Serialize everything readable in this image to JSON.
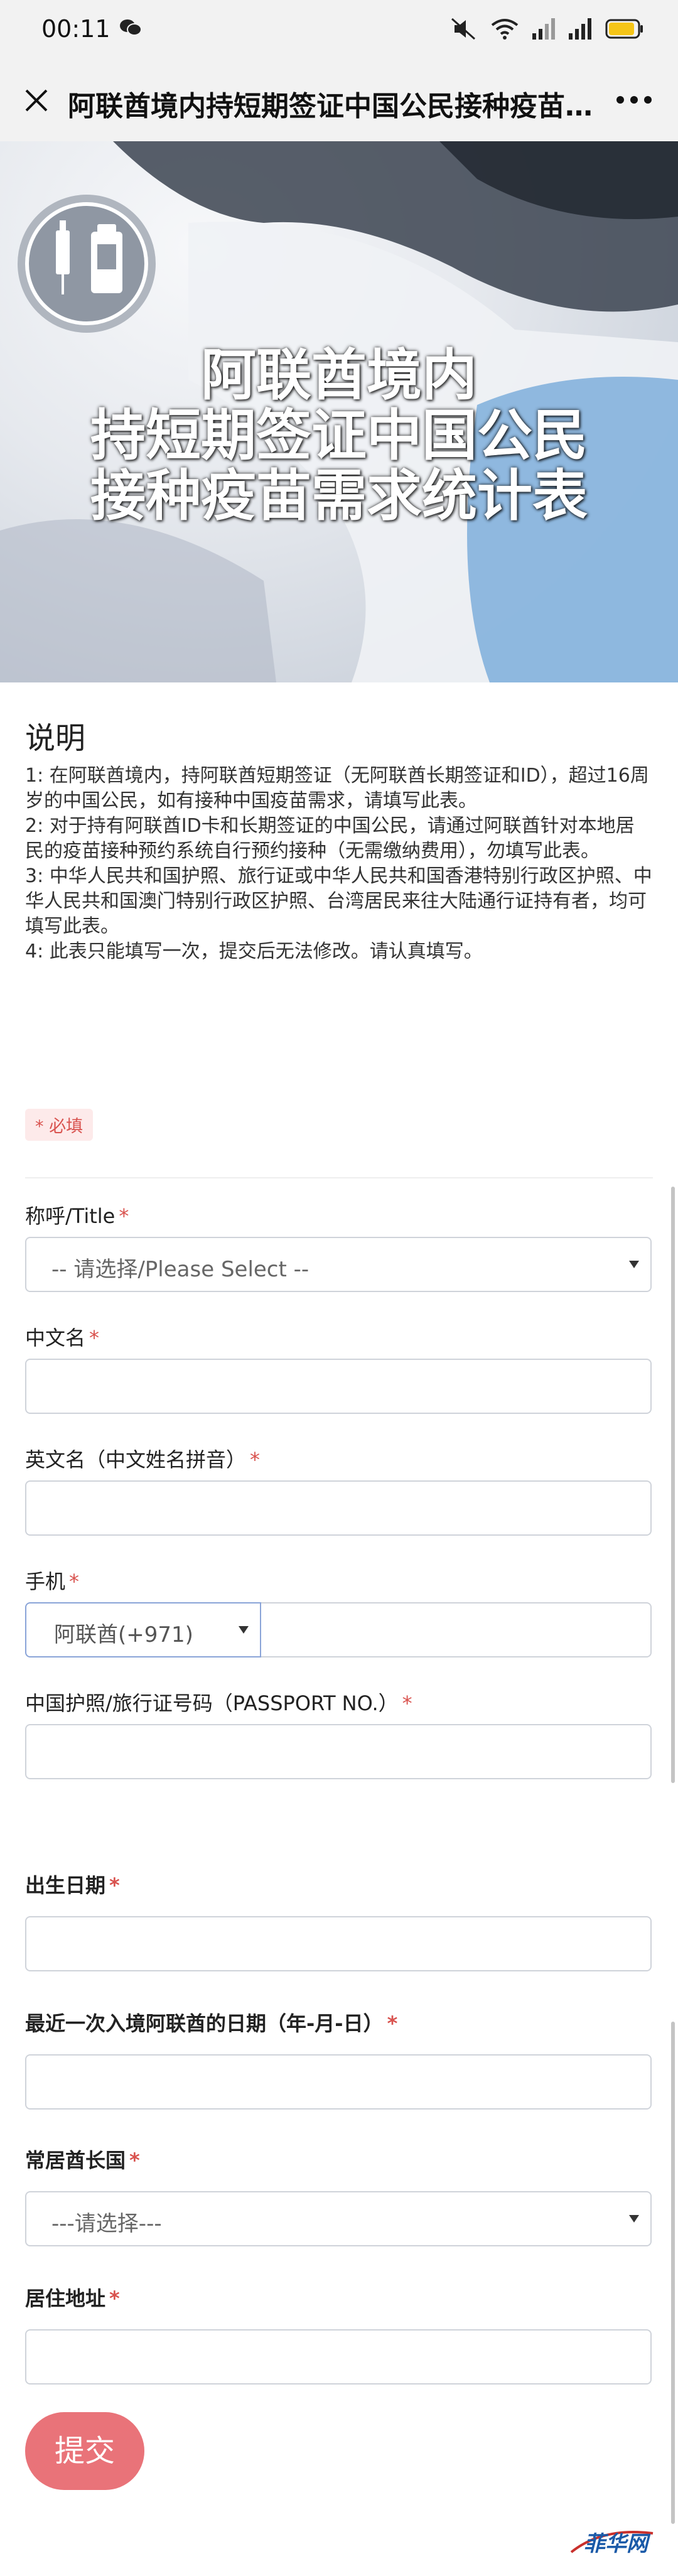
{
  "status_bar": {
    "time": "00:11"
  },
  "nav": {
    "title": "阿联酋境内持短期签证中国公民接种疫苗..."
  },
  "banner": {
    "title_lines": [
      "阿联酋境内",
      "持短期签证中国公民",
      "接种疫苗需求统计表"
    ]
  },
  "description": {
    "heading": "说明",
    "items": [
      "1: 在阿联酋境内，持阿联酋短期签证（无阿联酋长期签证和ID），超过16周岁的中国公民，如有接种中国疫苗需求，请填写此表。",
      "2: 对于持有阿联酋ID卡和长期签证的中国公民，请通过阿联酋针对本地居民的疫苗接种预约系统自行预约接种（无需缴纳费用），勿填写此表。",
      "3: 中华人民共和国护照、旅行证或中华人民共和国香港特别行政区护照、中华人民共和国澳门特别行政区护照、台湾居民来往大陆通行证持有者，均可填写此表。",
      "4: 此表只能填写一次，提交后无法修改。请认真填写。"
    ]
  },
  "required_badge": "* 必填",
  "form": {
    "title": {
      "label": "称呼/Title",
      "star": "*",
      "selected": "-- 请选择/Please Select --"
    },
    "chinese_name": {
      "label": "中文名",
      "star": "*",
      "value": ""
    },
    "english_name": {
      "label": "英文名（中文姓名拼音）",
      "star": "*",
      "value": ""
    },
    "phone": {
      "label": "手机",
      "star": "*",
      "country_code": "阿联酋(+971)",
      "value": ""
    },
    "passport": {
      "label": "中国护照/旅行证号码（PASSPORT NO.）",
      "star": "*",
      "value": ""
    },
    "birth_date": {
      "label": "出生日期",
      "star": "*",
      "value": ""
    },
    "last_entry": {
      "label": "最近一次入境阿联酋的日期（年-月-日）",
      "star": "*",
      "value": ""
    },
    "emirate": {
      "label": "常居酋长国",
      "star": "*",
      "selected": "---请选择---"
    },
    "address": {
      "label": "居住地址",
      "star": "*",
      "value": ""
    },
    "submit_label": "提交"
  },
  "watermark": "菲华网",
  "colors": {
    "accent": "#e97379",
    "required": "#d9534f",
    "nav_bg": "#f2f2f2"
  }
}
